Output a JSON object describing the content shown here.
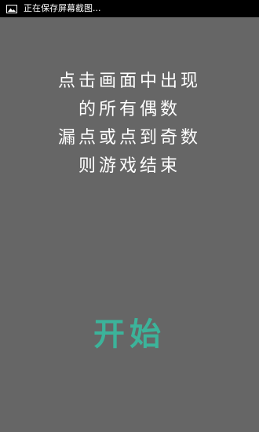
{
  "status_bar": {
    "icon": "image-icon",
    "text": "正在保存屏幕截图..."
  },
  "instructions": {
    "lines": [
      "点击画面中出现",
      "的所有偶数",
      "漏点或点到奇数",
      "则游戏结束"
    ]
  },
  "start_button": {
    "label": "开始"
  },
  "colors": {
    "background": "#666666",
    "status_bar": "#000000",
    "instruction_text": "#ffffff",
    "accent": "#3cb39a"
  }
}
